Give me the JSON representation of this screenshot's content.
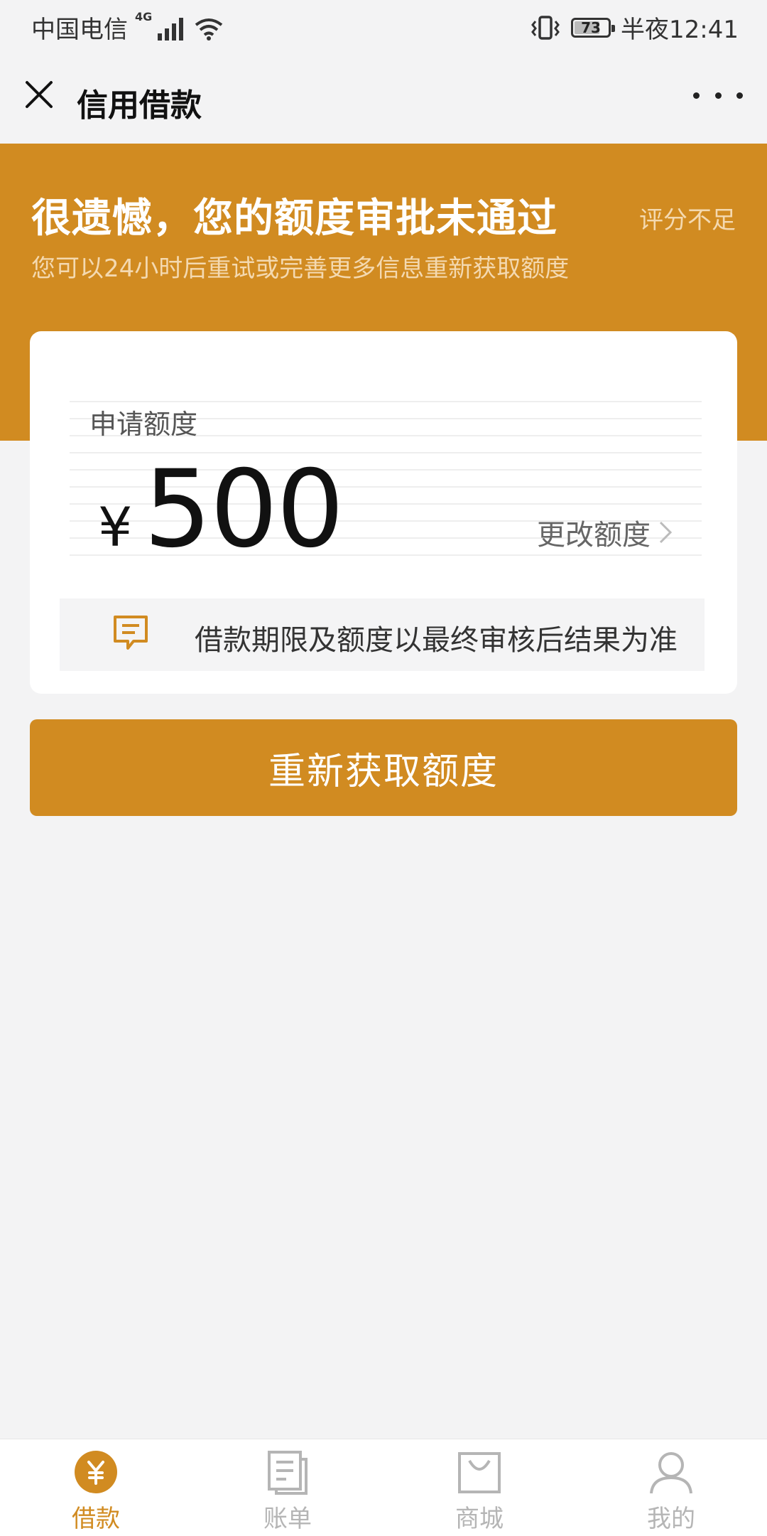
{
  "status_bar": {
    "carrier": "中国电信",
    "network": "4G",
    "battery": "73",
    "time": "半夜12:41"
  },
  "title_bar": {
    "title": "信用借款"
  },
  "banner": {
    "title": "很遗憾，您的额度审批未通过",
    "reason": "评分不足",
    "subtitle": "您可以24小时后重试或完善更多信息重新获取额度"
  },
  "card": {
    "apply_label": "申请额度",
    "currency": "¥",
    "amount": "500",
    "change_label": "更改额度",
    "notice": "借款期限及额度以最终审核后结果为准"
  },
  "primary_button": "重新获取额度",
  "tabbar": {
    "items": [
      {
        "label": "借款",
        "icon": "yen-circle-icon",
        "active": true
      },
      {
        "label": "账单",
        "icon": "bill-icon",
        "active": false
      },
      {
        "label": "商城",
        "icon": "shopping-bag-icon",
        "active": false
      },
      {
        "label": "我的",
        "icon": "user-icon",
        "active": false
      }
    ]
  },
  "colors": {
    "accent": "#d18b21",
    "background": "#f3f3f4",
    "inactive": "#b5b5b5"
  }
}
